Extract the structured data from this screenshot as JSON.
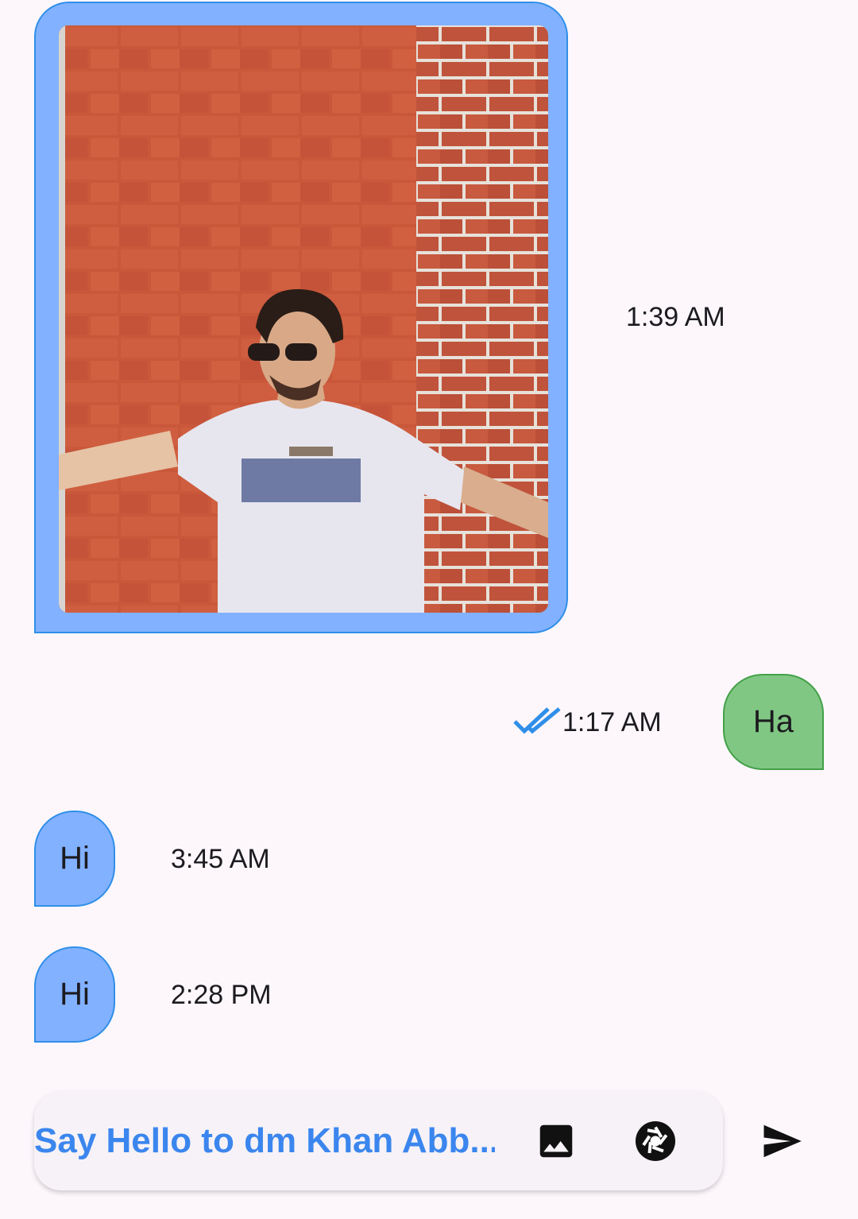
{
  "messages": {
    "image_message": {
      "time": "1:39 AM"
    },
    "sent_message": {
      "text": "Ha",
      "time": "1:17 AM",
      "status_icon": "double-check-icon",
      "status_color": "#2f8fe8"
    },
    "received_1": {
      "text": "Hi",
      "time": "3:45 AM"
    },
    "received_2": {
      "text": "Hi",
      "time": "2:28 PM"
    }
  },
  "composer": {
    "placeholder": "Say Hello to dm Khan Abb...",
    "gallery_icon": "image-icon",
    "camera_icon": "camera-shutter-icon",
    "send_icon": "send-icon"
  },
  "colors": {
    "received_bubble": "#82b1ff",
    "received_border": "#2f8fe8",
    "sent_bubble": "#81c784",
    "sent_border": "#43a047",
    "accent": "#2f80ed"
  }
}
